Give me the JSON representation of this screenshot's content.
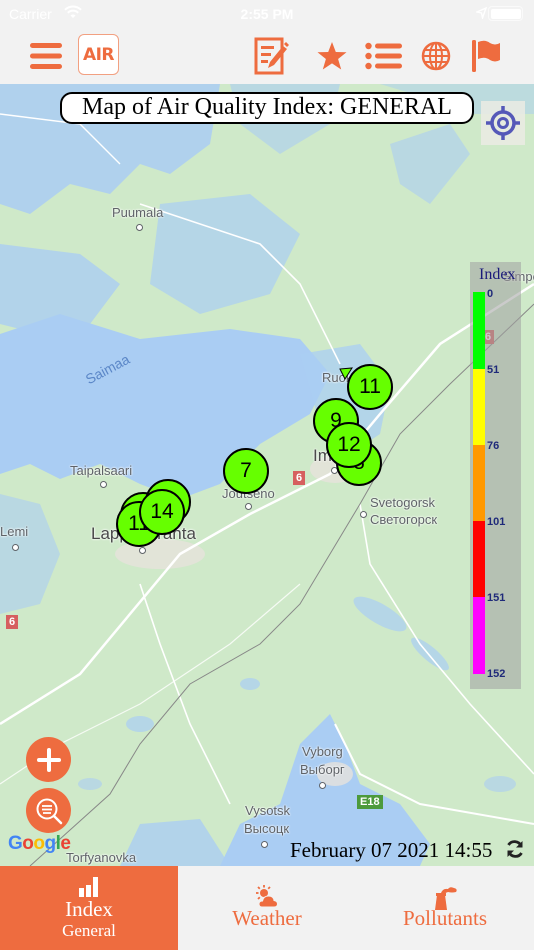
{
  "status_bar": {
    "carrier": "Carrier",
    "time": "2:55 PM"
  },
  "nav": {
    "logo_text": "AIR",
    "icons": [
      "menu-icon",
      "air-logo",
      "edit-note-icon",
      "star-icon",
      "list-icon",
      "globe-icon",
      "flag-icon"
    ]
  },
  "map": {
    "title": "Map of Air Quality Index: GENERAL",
    "places": [
      {
        "name": "Puumala"
      },
      {
        "name": "Saimaa"
      },
      {
        "name": "Taipalsaari"
      },
      {
        "name": "Lappeenranta"
      },
      {
        "name": "Lemi"
      },
      {
        "name": "Joutseno"
      },
      {
        "name": "Imatra"
      },
      {
        "name": "Ruokolahti"
      },
      {
        "name": "Svetogorsk"
      },
      {
        "name": "Светогорск"
      },
      {
        "name": "Vyborg"
      },
      {
        "name": "Выборг"
      },
      {
        "name": "Vysotsk"
      },
      {
        "name": "Высоцк"
      },
      {
        "name": "Torfyanovka"
      },
      {
        "name": "Simpele"
      }
    ],
    "road_shields": [
      "6",
      "6",
      "6",
      "E18"
    ],
    "markers": [
      {
        "value": "11",
        "label": "marker-ruokolahti"
      },
      {
        "value": "9",
        "label": "marker-imatra-north"
      },
      {
        "value": "8",
        "label": "marker-imatra-south"
      },
      {
        "value": "12",
        "label": "marker-imatra"
      },
      {
        "value": "7",
        "label": "marker-joutseno"
      },
      {
        "value": "",
        "label": "marker-lappeenranta-back"
      },
      {
        "value": "11",
        "label": "marker-lappeenranta"
      },
      {
        "value": "",
        "label": "marker-lappeenranta-back2"
      },
      {
        "value": "14",
        "label": "marker-lappeenranta-east"
      }
    ],
    "legend": {
      "title": "Index",
      "levels": [
        {
          "from": "0",
          "color": "#00ff00"
        },
        {
          "from": "51",
          "color": "#ffff00"
        },
        {
          "from": "76",
          "color": "#ff9900"
        },
        {
          "from": "101",
          "color": "#ff0000"
        },
        {
          "from": "151",
          "color": "#ff00ff"
        }
      ],
      "max_label": "152"
    },
    "google_label": "Google",
    "timestamp": "February 07 2021 14:55"
  },
  "tabs": [
    {
      "label": "Index",
      "sublabel": "General",
      "active": true
    },
    {
      "label": "Weather",
      "sublabel": "",
      "active": false
    },
    {
      "label": "Pollutants",
      "sublabel": "",
      "active": false
    }
  ],
  "colors": {
    "accent": "#ee6c3f",
    "marker_good": "#66ff00"
  }
}
